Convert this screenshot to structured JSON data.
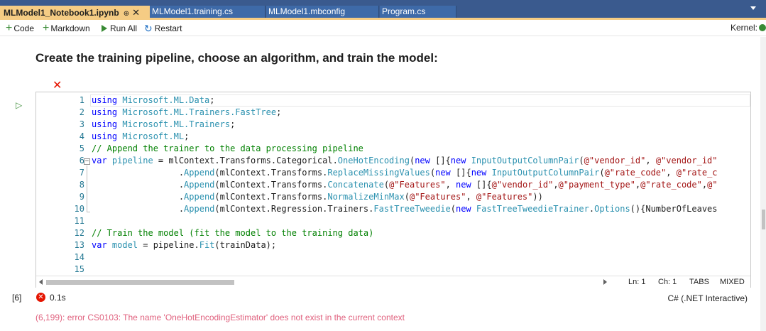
{
  "tabs": [
    {
      "label": "MLModel1_Notebook1.ipynb",
      "active": true,
      "pin": "⊕",
      "close": "✕"
    },
    {
      "label": "MLModel1.training.cs",
      "active": false
    },
    {
      "label": "MLModel1.mbconfig",
      "active": false
    },
    {
      "label": "Program.cs",
      "active": false
    }
  ],
  "toolbar": {
    "code_label": "Code",
    "markdown_label": "Markdown",
    "run_all_label": "Run All",
    "restart_label": "Restart",
    "kernel_label": "Kernel:"
  },
  "markdown_cell": {
    "heading": "Create the training pipeline, choose an algorithm, and train the model:"
  },
  "code_cell": {
    "line_numbers": [
      "1",
      "2",
      "3",
      "4",
      "5",
      "6",
      "7",
      "8",
      "9",
      "10",
      "11",
      "12",
      "13",
      "14",
      "15"
    ],
    "lines": [
      [
        {
          "t": "using ",
          "c": "k"
        },
        {
          "t": "Microsoft.ML.Data",
          "c": "ns"
        },
        {
          "t": ";",
          "c": ""
        }
      ],
      [
        {
          "t": "using ",
          "c": "k"
        },
        {
          "t": "Microsoft.ML.Trainers.FastTree",
          "c": "ns"
        },
        {
          "t": ";",
          "c": ""
        }
      ],
      [
        {
          "t": "using ",
          "c": "k"
        },
        {
          "t": "Microsoft.ML.Trainers",
          "c": "ns"
        },
        {
          "t": ";",
          "c": ""
        }
      ],
      [
        {
          "t": "using ",
          "c": "k"
        },
        {
          "t": "Microsoft.ML",
          "c": "ns"
        },
        {
          "t": ";",
          "c": ""
        }
      ],
      [
        {
          "t": "// Append the trainer to the data processing pipeline",
          "c": "cm"
        }
      ],
      [
        {
          "t": "var ",
          "c": "k"
        },
        {
          "t": "pipeline",
          "c": "ty"
        },
        {
          "t": " = mlContext.Transforms.Categorical.",
          "c": ""
        },
        {
          "t": "OneHotEncoding",
          "c": "ty"
        },
        {
          "t": "(",
          "c": ""
        },
        {
          "t": "new",
          "c": "k"
        },
        {
          "t": " []{",
          "c": ""
        },
        {
          "t": "new",
          "c": "k"
        },
        {
          "t": " ",
          "c": ""
        },
        {
          "t": "InputOutputColumnPair",
          "c": "ty"
        },
        {
          "t": "(",
          "c": ""
        },
        {
          "t": "@\"vendor_id\"",
          "c": "st"
        },
        {
          "t": ", ",
          "c": ""
        },
        {
          "t": "@\"vendor_id\"",
          "c": "st"
        }
      ],
      [
        {
          "t": "                 .",
          "c": ""
        },
        {
          "t": "Append",
          "c": "ty"
        },
        {
          "t": "(mlContext.Transforms.",
          "c": ""
        },
        {
          "t": "ReplaceMissingValues",
          "c": "ty"
        },
        {
          "t": "(",
          "c": ""
        },
        {
          "t": "new",
          "c": "k"
        },
        {
          "t": " []{",
          "c": ""
        },
        {
          "t": "new",
          "c": "k"
        },
        {
          "t": " ",
          "c": ""
        },
        {
          "t": "InputOutputColumnPair",
          "c": "ty"
        },
        {
          "t": "(",
          "c": ""
        },
        {
          "t": "@\"rate_code\"",
          "c": "st"
        },
        {
          "t": ", ",
          "c": ""
        },
        {
          "t": "@\"rate_c",
          "c": "st"
        }
      ],
      [
        {
          "t": "                 .",
          "c": ""
        },
        {
          "t": "Append",
          "c": "ty"
        },
        {
          "t": "(mlContext.Transforms.",
          "c": ""
        },
        {
          "t": "Concatenate",
          "c": "ty"
        },
        {
          "t": "(",
          "c": ""
        },
        {
          "t": "@\"Features\"",
          "c": "st"
        },
        {
          "t": ", ",
          "c": ""
        },
        {
          "t": "new",
          "c": "k"
        },
        {
          "t": " []{",
          "c": ""
        },
        {
          "t": "@\"vendor_id\"",
          "c": "st"
        },
        {
          "t": ",",
          "c": ""
        },
        {
          "t": "@\"payment_type\"",
          "c": "st"
        },
        {
          "t": ",",
          "c": ""
        },
        {
          "t": "@\"rate_code\"",
          "c": "st"
        },
        {
          "t": ",",
          "c": ""
        },
        {
          "t": "@\"",
          "c": "st"
        }
      ],
      [
        {
          "t": "                 .",
          "c": ""
        },
        {
          "t": "Append",
          "c": "ty"
        },
        {
          "t": "(mlContext.Transforms.",
          "c": ""
        },
        {
          "t": "NormalizeMinMax",
          "c": "ty"
        },
        {
          "t": "(",
          "c": ""
        },
        {
          "t": "@\"Features\"",
          "c": "st"
        },
        {
          "t": ", ",
          "c": ""
        },
        {
          "t": "@\"Features\"",
          "c": "st"
        },
        {
          "t": "))",
          "c": ""
        }
      ],
      [
        {
          "t": "                 .",
          "c": ""
        },
        {
          "t": "Append",
          "c": "ty"
        },
        {
          "t": "(mlContext.Regression.Trainers.",
          "c": ""
        },
        {
          "t": "FastTreeTweedie",
          "c": "ty"
        },
        {
          "t": "(",
          "c": ""
        },
        {
          "t": "new",
          "c": "k"
        },
        {
          "t": " ",
          "c": ""
        },
        {
          "t": "FastTreeTweedieTrainer",
          "c": "ty"
        },
        {
          "t": ".",
          "c": ""
        },
        {
          "t": "Options",
          "c": "ty"
        },
        {
          "t": "(){NumberOfLeaves",
          "c": ""
        }
      ],
      [],
      [
        {
          "t": "// Train the model (fit the model to the training data)",
          "c": "cm"
        }
      ],
      [
        {
          "t": "var ",
          "c": "k"
        },
        {
          "t": "model",
          "c": "ty"
        },
        {
          "t": " = pipeline.",
          "c": ""
        },
        {
          "t": "Fit",
          "c": "ty"
        },
        {
          "t": "(trainData);",
          "c": ""
        }
      ],
      [],
      []
    ]
  },
  "editor_status": {
    "line": "Ln: 1",
    "col": "Ch: 1",
    "indent": "TABS",
    "line_endings": "MIXED"
  },
  "execution": {
    "count": "[6]",
    "time": "0.1s",
    "kernel_language": "C# (.NET Interactive)",
    "error_icon": "✕",
    "error_message": "(6,199): error CS0103: The name 'OneHotEncodingEstimator' does not exist in the current context"
  }
}
